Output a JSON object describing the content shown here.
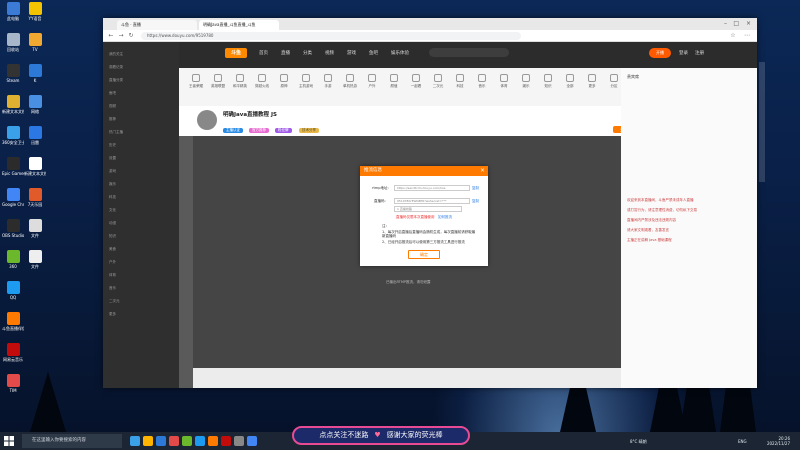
{
  "desktop": {
    "icons": [
      {
        "label": "此电脑",
        "color": "#3b7bd6"
      },
      {
        "label": "回收站",
        "color": "#a7b6c8"
      },
      {
        "label": "Steam",
        "color": "#333333"
      },
      {
        "label": "新建文本文档",
        "color": "#e0b030"
      },
      {
        "label": "360安全卫士",
        "color": "#3aa0e8"
      },
      {
        "label": "Epic Games Launcher",
        "color": "#2b2b2b"
      },
      {
        "label": "Google Chrome",
        "color": "#4285f4"
      },
      {
        "label": "OBS Studio",
        "color": "#2c2c2c"
      },
      {
        "label": "360",
        "color": "#6bb82c"
      },
      {
        "label": "QQ",
        "color": "#1d9bf0"
      },
      {
        "label": "斗鱼直播伴侣",
        "color": "#ff7a00"
      },
      {
        "label": "网易云音乐",
        "color": "#c20c0c"
      },
      {
        "label": "TIM",
        "color": "#e34a4a"
      }
    ],
    "icons_col2": [
      {
        "label": "YY语音",
        "color": "#f5c400"
      },
      {
        "label": "TV",
        "color": "#f0a830"
      },
      {
        "label": "K",
        "color": "#2c79d8"
      },
      {
        "label": "网络",
        "color": "#4a90e2"
      },
      {
        "label": "迅雷",
        "color": "#2b78e4"
      },
      {
        "label": "新建文本文档",
        "color": "#ffffff"
      },
      {
        "label": "7天乐园",
        "color": "#e05a2a"
      },
      {
        "label": "文件",
        "color": "#dddddd"
      },
      {
        "label": "文件",
        "color": "#eeeeee"
      }
    ]
  },
  "browser": {
    "tabs": [
      {
        "label": "斗鱼 · 直播"
      },
      {
        "label": "明确Java直播_斗鱼直播_斗鱼"
      }
    ],
    "address": "https://www.douyu.com/9519780",
    "topnav": {
      "logo": "斗鱼",
      "items": [
        "首页",
        "直播",
        "分类",
        "视频",
        "游戏",
        "鱼吧",
        "娱乐体验"
      ],
      "actions": [
        "开播",
        "登录",
        "注册"
      ]
    },
    "categories": [
      "王者荣耀",
      "英雄联盟",
      "和平精英",
      "穿越火线",
      "原神",
      "主机游戏",
      "手游",
      "单机热游",
      "户外",
      "颜值",
      "一起看",
      "二次元",
      "科技",
      "音乐",
      "体育",
      "娱乐",
      "知识",
      "全部",
      "更多",
      "分区",
      "推荐"
    ],
    "room": {
      "title": "明确Java直播教程 JS",
      "tags": [
        "主播认证",
        "官方推荐",
        "粉丝牌",
        "技术分享"
      ],
      "follow": "关注"
    },
    "left_nav": [
      "我的关注",
      "观看记录",
      "直播分类",
      "鱼吧",
      "视频",
      "推荐",
      "热门主播",
      "历史",
      "设置",
      "游戏",
      "娱乐",
      "科技",
      "文化",
      "动漫",
      "知识",
      "美食",
      "户外",
      "体育",
      "音乐",
      "二次元",
      "更多"
    ],
    "right_panel": {
      "header": "贵宾席",
      "lines": [
        "欢迎来到本直播间，斗鱼严禁未成年人直播",
        "或打赏行为，请注意理性消费，切勿私下交易",
        "直播间内严禁涉及违法违规内容",
        "请大家文明观看，友善发言",
        "主播正在讲解 Java 基础课程"
      ]
    }
  },
  "dialog": {
    "title": "推流信息",
    "close": "×",
    "rtmp_label": "rtmp地址:",
    "rtmp_value": "https://sendtcdn.douyu.com/live",
    "rtmp_copy": "复制",
    "key_label": "直播码:",
    "key_value": "9519780rEWb8ER?wsSecret=***",
    "key_copy": "复制",
    "select_value": "1 直播线路",
    "warn": "直播码仅限本次直播使用",
    "refresh": "如何推流",
    "note_title": "注：",
    "notes": [
      "1、每次开启直播后直播码会随机生成，每次直播前请获取最新直播码",
      "2、已经开启推流后可以使用第三方推流工具进行推流"
    ],
    "ok": "确定",
    "footer": "已输出RTMP推流，请勿泄露"
  },
  "taskbar": {
    "search_placeholder": "在这里输入你要搜索的内容",
    "weather": "8°C 晴朗",
    "ime": "ENG",
    "time": "20:26",
    "date": "2022/11/27"
  },
  "overlay": {
    "left": "点点关注不迷路",
    "heart": "♥",
    "right": "感谢大家的荧光棒"
  }
}
